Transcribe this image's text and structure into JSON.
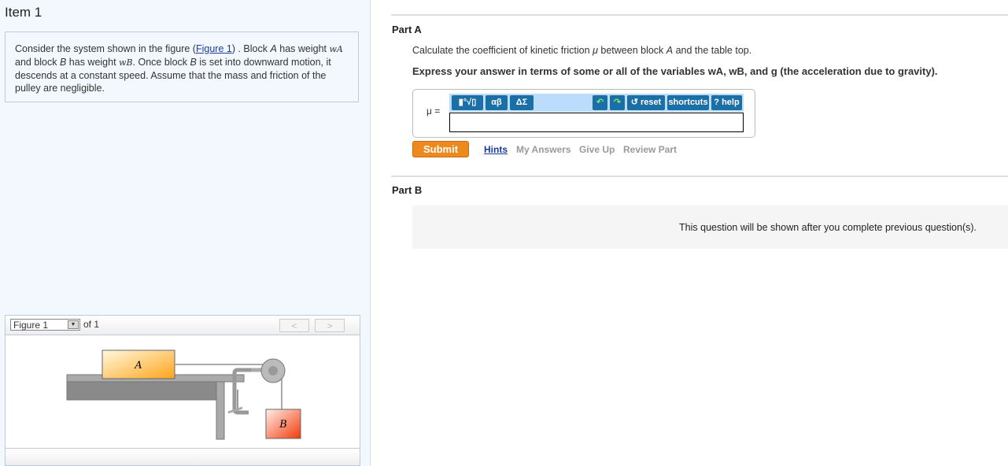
{
  "item": {
    "title": "Item 1"
  },
  "question": {
    "t1": "Consider the system shown in the figure (",
    "link": "Figure 1",
    "t2": ") . Block ",
    "A": "A",
    "t3": " has weight ",
    "wA": "wA",
    "t4": " and block ",
    "B": "B",
    "t5": " has weight ",
    "wB": "wB",
    "t6": ". Once block ",
    "B2": "B",
    "t7": " is set into downward motion, it descends at a constant speed. Assume that the mass and friction of the pulley are negligible."
  },
  "figure": {
    "select": "Figure 1",
    "of": "of 1",
    "prev": "<",
    "next": ">",
    "label_a": "A",
    "label_b": "B"
  },
  "partA": {
    "title": "Part A",
    "q1": "Calculate the coefficient of kinetic friction ",
    "mu": "μ",
    "q2": " between block ",
    "A": "A",
    "q3": " and the table top.",
    "instr": "Express your answer in terms of some or all of the variables wA, wB, and g (the acceleration due to gravity).",
    "label": "μ =",
    "answer": "",
    "toolbar": {
      "templates": "▮°√▯",
      "greek": "αβ",
      "symbols": "ΔΣ",
      "undo": "↶",
      "redo": "↷",
      "reset": "↺ reset",
      "shortcuts": "shortcuts",
      "help": "? help"
    },
    "submit": "Submit",
    "links": [
      "Hints",
      "My Answers",
      "Give Up",
      "Review Part"
    ]
  },
  "partB": {
    "title": "Part B",
    "message": "This question will be shown after you complete previous question(s)."
  }
}
